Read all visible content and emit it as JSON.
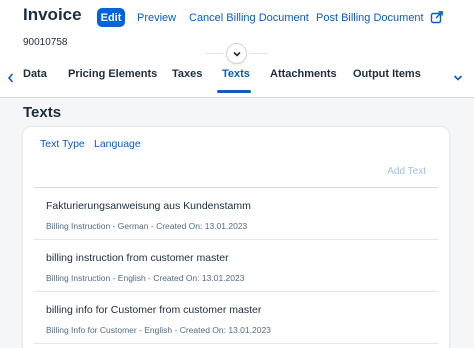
{
  "header": {
    "title": "Invoice",
    "subtitle": "90010758",
    "actions": {
      "edit": "Edit",
      "preview": "Preview",
      "cancel": "Cancel Billing Document",
      "post": "Post Billing Document"
    }
  },
  "tabs": [
    "Data",
    "Pricing Elements",
    "Taxes",
    "Texts",
    "Attachments",
    "Output Items"
  ],
  "active_tab": "Texts",
  "section": {
    "title": "Texts",
    "column_tabs": [
      "Text Type",
      "Language"
    ],
    "add_text": "Add Text",
    "rows": [
      {
        "title": "Fakturierungsanweisung aus Kundenstamm",
        "sub": "Billing Instruction - German - Created On: 13.01.2023"
      },
      {
        "title": "billing instruction from customer master",
        "sub": "Billing Instruction - English - Created On: 13.01.2023"
      },
      {
        "title": "billing info for Customer from customer master",
        "sub": "Billing Info for Customer - English - Created On: 13.01.2023"
      }
    ]
  },
  "colors": {
    "accent": "#0a5cbf",
    "button": "#0064d9",
    "text": "#1d2d3e",
    "muted": "#556b82"
  },
  "icons": [
    "share-icon",
    "chevron-down-icon",
    "chevron-left-icon",
    "chevron-right-icon"
  ]
}
